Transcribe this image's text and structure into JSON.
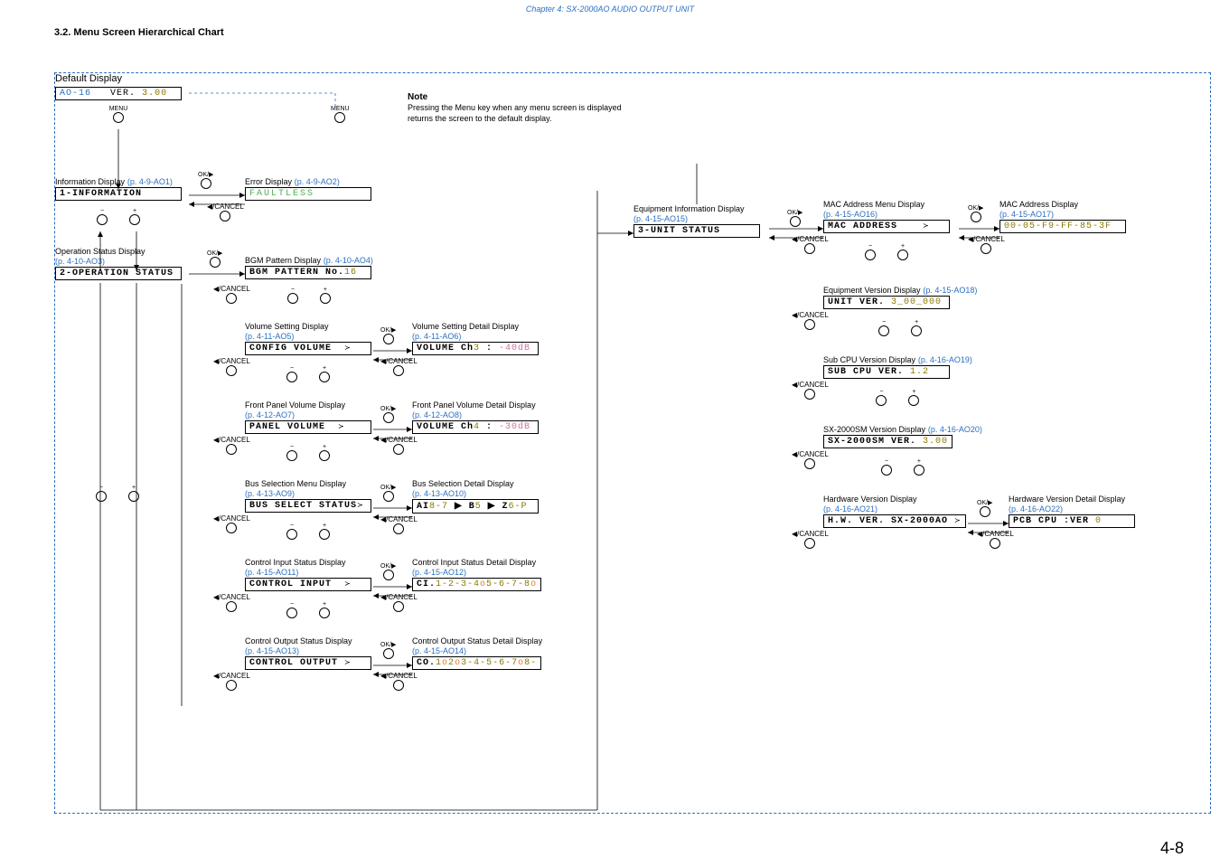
{
  "chapter": "Chapter 4:  SX-2000AO AUDIO OUTPUT UNIT",
  "section": "3.2. Menu Screen Hierarchical Chart",
  "page_number": "4-8",
  "default_display_label": "Default Display",
  "default_lcd_left": "AO-16",
  "default_lcd_right_prefix": "VER.",
  "default_lcd_right_ver": "3.00",
  "menu_btn": "MENU",
  "ok_btn": "OK/▶",
  "cancel_btn": "◀/CANCEL",
  "plus": "+",
  "minus": "−",
  "note_title": "Note",
  "note_body": "Pressing the Menu key when any menu screen is displayed returns the screen to the default display.",
  "info_display_title": "Information Display",
  "info_display_ref": "(p. 4-9-AO1)",
  "info_lcd": "1-INFORMATION",
  "error_display_title": "Error Display",
  "error_display_ref": "(p. 4-9-AO2)",
  "error_lcd": "FAULTLESS",
  "op_status_title": "Operation Status Display",
  "op_status_ref": "(p. 4-10-AO3)",
  "op_status_lcd": "2-OPERATION STATUS",
  "bgm_title": "BGM Pattern Display",
  "bgm_ref": "(p. 4-10-AO4)",
  "bgm_lcd_prefix": "BGM PATTERN No.",
  "bgm_lcd_val": "16",
  "vol_title": "Volume Setting Display",
  "vol_ref": "(p. 4-11-AO5)",
  "vol_lcd": "CONFIG VOLUME",
  "vol_detail_title": "Volume Setting Detail Display",
  "vol_detail_ref": "(p. 4-11-AO6)",
  "vol_detail_lcd_p1": "VOLUME Ch",
  "vol_detail_lcd_ch": "3",
  "vol_detail_lcd_p2": "  : ",
  "vol_detail_lcd_db": "-40dB",
  "panel_vol_title": "Front Panel Volume Display",
  "panel_vol_ref": "(p. 4-12-AO7)",
  "panel_vol_lcd": "PANEL VOLUME",
  "panel_vol_detail_title": "Front Panel Volume Detail Display",
  "panel_vol_detail_ref": "(p. 4-12-AO8)",
  "panel_vol_detail_lcd_p1": "VOLUME Ch",
  "panel_vol_detail_lcd_ch": "4",
  "panel_vol_detail_lcd_p2": "  : ",
  "panel_vol_detail_lcd_db": "-30dB",
  "bus_title": "Bus Selection Menu Display",
  "bus_ref": "(p. 4-13-AO9)",
  "bus_lcd": "BUS SELECT STATUS",
  "bus_detail_title": "Bus Selection Detail Display",
  "bus_detail_ref": "(p. 4-13-AO10)",
  "bus_detail_p1": "AI",
  "bus_detail_v1": "8-7",
  "bus_detail_p2": " ▶ B",
  "bus_detail_v2": "5",
  "bus_detail_p3": "   ▶ Z",
  "bus_detail_v3": "6-P",
  "cin_title": "Control Input Status Display",
  "cin_ref": "(p. 4-15-AO11)",
  "cin_lcd": "CONTROL INPUT",
  "cin_detail_title": "Control Input Status Detail Display",
  "cin_detail_ref": "(p. 4-15-AO12)",
  "cin_detail_lcd": "CI.1-2-3-4o5-6-7-8o",
  "cout_title": "Control Output Status Display",
  "cout_ref": "(p. 4-15-AO13)",
  "cout_lcd": "CONTROL OUTPUT",
  "cout_detail_title": "Control Output Status Detail Display",
  "cout_detail_ref": "(p. 4-15-AO14)",
  "cout_detail_lcd": "CO.1o2o3-4-5-6-7o8-",
  "equip_title": "Equipment Information Display",
  "equip_ref": "(p. 4-15-AO15)",
  "equip_lcd": "3-UNIT STATUS",
  "mac_menu_title": "MAC Address Menu Display",
  "mac_menu_ref": "(p. 4-15-AO16)",
  "mac_menu_lcd": "MAC ADDRESS",
  "mac_detail_title": "MAC Address Display",
  "mac_detail_ref": "(p. 4-15-AO17)",
  "mac_detail_lcd": "00-05-F9-FF-85-3F",
  "unit_ver_title": "Equipment Version Display",
  "unit_ver_ref": "(p. 4-15-AO18)",
  "unit_ver_lcd_p": "UNIT VER.",
  "unit_ver_lcd_v": "3_00_000",
  "sub_cpu_title": "Sub CPU Version Display",
  "sub_cpu_ref": "(p. 4-16-AO19)",
  "sub_cpu_lcd_p": "SUB CPU VER.",
  "sub_cpu_lcd_v": "1.2",
  "sx_title": "SX-2000SM Version Display",
  "sx_ref": "(p. 4-16-AO20)",
  "sx_lcd_p": "SX-2000SM   VER.",
  "sx_lcd_v": "3.00",
  "hw_title": "Hardware Version Display",
  "hw_ref": "(p. 4-16-AO21)",
  "hw_lcd": "H.W. VER. SX-2000AO",
  "hw_detail_title": "Hardware Version Detail Display",
  "hw_detail_ref": "(p. 4-16-AO22)",
  "hw_detail_lcd_p": "PCB CPU     :VER ",
  "hw_detail_lcd_v": "0",
  "arrow_right": "≻",
  "arrow_left": "◀"
}
